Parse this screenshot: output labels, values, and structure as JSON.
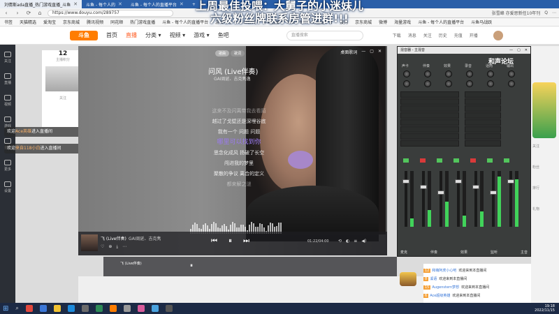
{
  "browser": {
    "tabs": [
      {
        "label": "刘倩斯ada直播_热门游戏直播_斗鱼",
        "active": true
      },
      {
        "label": "斗鱼 - 每个人的",
        "active": false
      },
      {
        "label": "斗鱼 - 每个人的直播平台",
        "active": false
      },
      {
        "label": "+",
        "active": false
      }
    ],
    "url": "https://www.douyu.com/289757",
    "address_right": [
      "张雪峰 亦爱思新任10年刊",
      "Q",
      "⋯"
    ],
    "bookmarks": [
      "书签",
      "天猫精选",
      "爱淘宝",
      "京东商城",
      "腾讯视频",
      "同花顺",
      "热门游戏直播",
      "斗鱼 - 每个人的直播平台",
      "游戏中心",
      "斗鱼聊天",
      "斗鱼直播",
      "斗鱼 - 每个人的直播平台",
      "搜狗",
      "京东商城",
      "微博",
      "海量游戏",
      "斗鱼 - 每个人的直播平台",
      "斗鱼马战跃"
    ]
  },
  "banner": {
    "line1": "上周最佳投喂：大舅子的小迷妹儿",
    "line2": "六级粉丝牌联系房管进群!!!"
  },
  "douyu": {
    "logo": "斗鱼",
    "nav": [
      "首页",
      "直播",
      "分类 ▾",
      "视频 ▾",
      "游戏 ▾",
      "鱼吧"
    ],
    "active_nav": "直播",
    "search_placeholder": "直播搜索",
    "icons": [
      "下载",
      "消息",
      "关注",
      "历史",
      "充值",
      "开播"
    ]
  },
  "sidebar": [
    "关注",
    "直播",
    "视频",
    "游戏",
    "鱼吧",
    "更多",
    "设置"
  ],
  "anchor": {
    "count": "12",
    "label": "主播积分",
    "follow_label": "关注"
  },
  "left_chat": [
    {
      "prefix": "欢迎",
      "name": "Ace英雄",
      "suffix": "进入直播间"
    },
    {
      "prefix": "欢迎",
      "name": "来自118小白",
      "suffix": "进入直播间"
    }
  ],
  "player": {
    "toggle": [
      "歌曲",
      "歌词"
    ],
    "toggle_active": "歌曲",
    "window_buttons": [
      "桌面歌词",
      "—",
      "▢",
      "✕"
    ],
    "song_title": "问风 (Live伴奏)",
    "artist": "GAI周延、吉克隽逸",
    "lyrics": [
      {
        "text": "这来不及闪离带我去看陌",
        "state": "dim"
      },
      {
        "text": "越过了戈壁还是深埋谷底",
        "state": "normal"
      },
      {
        "text": "我有一个 问题 问题",
        "state": "normal"
      },
      {
        "text": "哪里可以找到你",
        "state": "active"
      },
      {
        "text": "思念化成风 扬破了长空",
        "state": "normal"
      },
      {
        "text": "闯进我的梦里",
        "state": "normal"
      },
      {
        "text": "聚散的争议 离合的定义",
        "state": "normal"
      },
      {
        "text": "都来解之谜",
        "state": "dim"
      }
    ],
    "bar_title": "飞 (Live伴奏)",
    "bar_artist": "GAI周延、吉克隽",
    "time": "01:22/04:00",
    "controls": [
      "⏮",
      "⏸",
      "⏭"
    ],
    "mini_icons": [
      "♡",
      "⊕",
      "⤓",
      "⋯"
    ],
    "right_icons": [
      "⟲",
      "◐",
      "≡",
      "◀)"
    ],
    "progress": 0.34
  },
  "mixer": {
    "title": "混音器 - 主混音",
    "buttons": [
      "—",
      "▢",
      "✕"
    ],
    "brand": "和声论坛",
    "labels": [
      "声卡",
      "伴奏",
      "效果",
      "录音",
      "话筒",
      "输出"
    ],
    "meters": [
      0.15,
      0.3,
      0.45,
      0.2,
      0.28,
      0.9,
      0.85
    ],
    "footer": [
      "麦克",
      "伴奏",
      "效果",
      "监听",
      "主音"
    ]
  },
  "right_panel": {
    "items": [
      "关注",
      "粉丝",
      "排行",
      "礼物"
    ]
  },
  "bottom_chat": [
    {
      "lv": "12",
      "name": "和萌阿虎小心吧",
      "text": "欢迎来到本直播间"
    },
    {
      "lv": "8",
      "name": "溪语",
      "text": "欢迎来到本直播间"
    },
    {
      "lv": "15",
      "name": "Augenstern梦想",
      "text": "欢迎来到本直播间"
    },
    {
      "lv": "6",
      "name": "Ace超级英雄",
      "text": "欢迎来到本直播间"
    }
  ],
  "taskbar": {
    "start": "⊞",
    "search": "⌕",
    "icon_colors": [
      "#e2483d",
      "#3b77d8",
      "#f1c232",
      "#1c8adb",
      "#6b6b6b",
      "#2e8b57",
      "#ff7d00",
      "#999999",
      "#d85b9b",
      "#4aa3df",
      "#555555"
    ],
    "time": "19:18",
    "date": "2022/11/15"
  }
}
